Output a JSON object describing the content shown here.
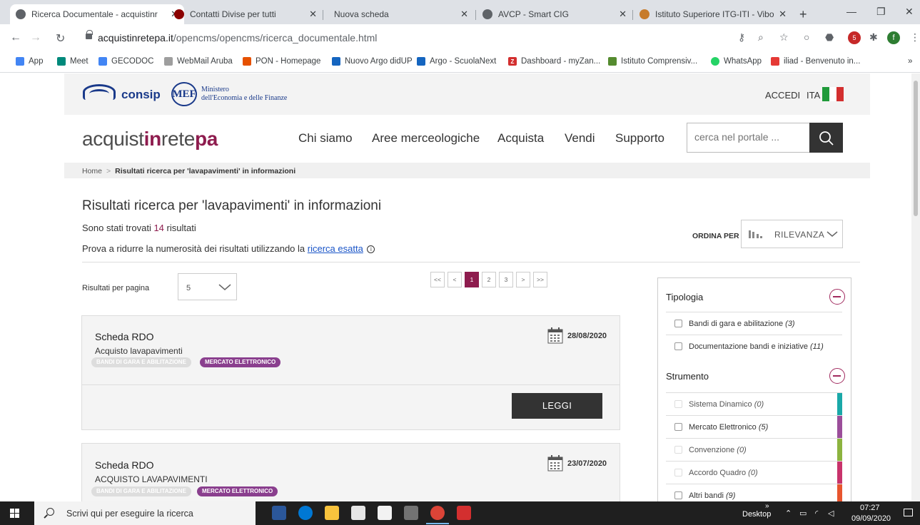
{
  "browser": {
    "tabs": [
      {
        "title": "Ricerca Documentale - acquistinr",
        "active": true
      },
      {
        "title": "Contatti Divise per tutti",
        "active": false
      },
      {
        "title": "Nuova scheda",
        "active": false
      },
      {
        "title": "AVCP - Smart CIG",
        "active": false
      },
      {
        "title": "Istituto Superiore ITG-ITI - Vibo \\",
        "active": false
      }
    ],
    "url_domain": "acquistinretepa.it",
    "url_path": "/opencms/opencms/ricerca_documentale.html",
    "bookmarks": [
      {
        "label": "App",
        "color": "#f4b400"
      },
      {
        "label": "Meet",
        "color": "#00897b"
      },
      {
        "label": "GECODOC",
        "color": "#4285f4"
      },
      {
        "label": "WebMail Aruba",
        "color": "#9e9e9e"
      },
      {
        "label": "PON - Homepage",
        "color": "#e65100"
      },
      {
        "label": "Nuovo Argo didUP",
        "color": "#1565c0"
      },
      {
        "label": "Argo - ScuolaNext",
        "color": "#1565c0"
      },
      {
        "label": "Dashboard - myZan...",
        "color": "#d32f2f"
      },
      {
        "label": "Istituto Comprensiv...",
        "color": "#558b2f"
      },
      {
        "label": "WhatsApp",
        "color": "#25d366"
      },
      {
        "label": "iliad - Benvenuto in...",
        "color": "#e53935"
      }
    ],
    "bookmarks_more": "»",
    "ext_badge_text": "5"
  },
  "header": {
    "consip_label": "consip",
    "mef_label": "MEF",
    "mef_sub_1": "Ministero",
    "mef_sub_2": "dell'Economia e delle Finanze",
    "login_label": "ACCEDI",
    "lang_label": "ITA",
    "logo_parts": [
      "acquist",
      "in",
      "rete",
      "pa"
    ],
    "nav": [
      "Chi siamo",
      "Aree merceologiche",
      "Acquista",
      "Vendi",
      "Supporto"
    ],
    "search_placeholder": "cerca nel portale ..."
  },
  "breadcrumb": {
    "home": "Home",
    "current": "Risultati ricerca per 'lavapavimenti' in informazioni"
  },
  "results": {
    "title": "Risultati ricerca per 'lavapavimenti' in informazioni",
    "count_prefix": "Sono stati trovati ",
    "count": "14",
    "count_suffix": " risultati",
    "hint_prefix": "Prova a ridurre la numerosità dei risultati utilizzando la ",
    "hint_link": "ricerca esatta",
    "info_glyph": "i",
    "order_label": "ORDINA PER",
    "order_value": "RILEVANZA",
    "per_page_label": "Risultati per pagina",
    "per_page_value": "5",
    "pager": [
      "<<",
      "<",
      "1",
      "2",
      "3",
      ">",
      ">>"
    ],
    "pager_current": "1",
    "read_label": "LEGGI",
    "cards": [
      {
        "type": "Scheda RDO",
        "desc": "Acquisto lavapavimenti",
        "date": "28/08/2020",
        "tags": [
          "BANDI DI GARA E ABILITAZIONE",
          "MERCATO ELETTRONICO"
        ]
      },
      {
        "type": "Scheda RDO",
        "desc": "ACQUISTO LAVAPAVIMENTI",
        "date": "23/07/2020",
        "tags": [
          "BANDI DI GARA E ABILITAZIONE",
          "MERCATO ELETTRONICO"
        ]
      }
    ]
  },
  "filters": {
    "tipologia_title": "Tipologia",
    "tipologia_items": [
      {
        "label": "Bandi di gara e abilitazione",
        "count": "(3)"
      },
      {
        "label": "Documentazione bandi e iniziative",
        "count": "(11)"
      }
    ],
    "strumento_title": "Strumento",
    "strumento_items": [
      {
        "label": "Sistema Dinamico",
        "count": "(0)",
        "color": "#1aa8a8",
        "disabled": true
      },
      {
        "label": "Mercato Elettronico",
        "count": "(5)",
        "color": "#9b4e9a",
        "disabled": false
      },
      {
        "label": "Convenzione",
        "count": "(0)",
        "color": "#8cb33f",
        "disabled": true
      },
      {
        "label": "Accordo Quadro",
        "count": "(0)",
        "color": "#c8336b",
        "disabled": true
      },
      {
        "label": "Altri bandi",
        "count": "(9)",
        "color": "#e8552e",
        "disabled": false
      }
    ]
  },
  "taskbar": {
    "search_text": "Scrivi qui per eseguire la ricerca",
    "desktop_label": "Desktop",
    "overflow_label": "»",
    "time": "07:27",
    "date": "09/09/2020"
  },
  "colors": {
    "brand": "#8e1c4e",
    "dark_button": "#333333",
    "link": "#1a55c8",
    "tag_purple": "#8a3f8e",
    "flag_green": "#1f9a3a",
    "flag_red": "#d32f2f"
  }
}
